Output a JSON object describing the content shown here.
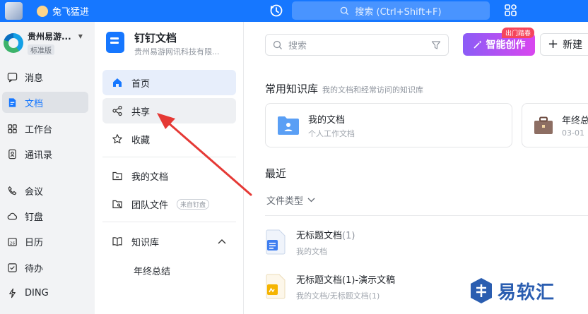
{
  "titlebar": {
    "tab_label": "兔飞猛进",
    "search_placeholder": "搜索 (Ctrl+Shift+F)"
  },
  "org": {
    "name": "贵州易游...",
    "badge": "标准版"
  },
  "leftnav": {
    "items": [
      {
        "label": "消息",
        "icon": "message-icon"
      },
      {
        "label": "文档",
        "icon": "doc-icon",
        "active": true
      },
      {
        "label": "工作台",
        "icon": "grid-icon"
      },
      {
        "label": "通讯录",
        "icon": "contacts-icon"
      },
      {
        "label": "会议",
        "icon": "phone-icon"
      },
      {
        "label": "钉盘",
        "icon": "cloud-icon"
      },
      {
        "label": "日历",
        "icon": "calendar-icon"
      },
      {
        "label": "待办",
        "icon": "todo-icon"
      },
      {
        "label": "DING",
        "icon": "ding-icon"
      }
    ]
  },
  "docnav": {
    "app_title": "钉钉文档",
    "app_subtitle": "贵州易游网讯科技有限...",
    "items": [
      {
        "label": "首页"
      },
      {
        "label": "共享"
      },
      {
        "label": "收藏"
      },
      {
        "label": "我的文档"
      },
      {
        "label": "团队文件",
        "tag": "来自钉盘"
      },
      {
        "label": "知识库"
      }
    ],
    "knowledge_sub": "年终总结"
  },
  "main": {
    "search_placeholder": "搜索",
    "ai_button": "智能创作",
    "ai_badge": "出门踏春",
    "new_button": "新建",
    "kb_section_title": "常用知识库",
    "kb_section_sub": "我的文档和经常访问的知识库",
    "kb_cards": [
      {
        "title": "我的文档",
        "sub": "个人工作文档"
      },
      {
        "title": "年终总",
        "sub": "03-01"
      }
    ],
    "recent_title": "最近",
    "filter_label": "文件类型",
    "files": [
      {
        "name": "无标题文档",
        "suffix": "(1)",
        "path": "我的文档",
        "path_suffix": ""
      },
      {
        "name": "无标题文档(1)-演示文稿",
        "suffix": "",
        "path": "我的文档/无标题文档",
        "path_suffix": "(1)"
      }
    ]
  },
  "watermark": {
    "text": "易软汇"
  },
  "colors": {
    "accent": "#1677ff",
    "arrow": "#e53935"
  }
}
